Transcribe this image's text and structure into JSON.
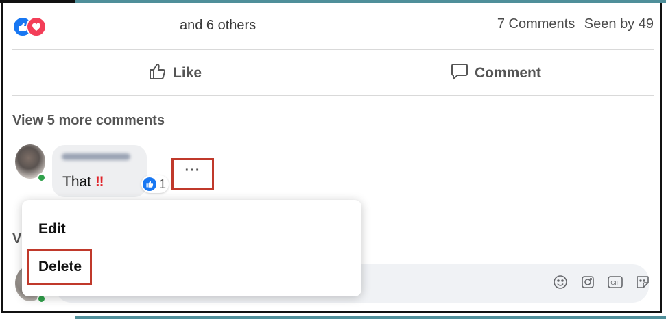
{
  "post_stats": {
    "reaction_icons": [
      "like-icon",
      "love-icon"
    ],
    "reactors_text": "and 6 others",
    "comments_count": "7 Comments",
    "seen_by": "Seen by 49"
  },
  "actions": {
    "like_label": "Like",
    "comment_label": "Comment"
  },
  "comments": {
    "view_more_label": "View 5 more comments",
    "items": [
      {
        "author_blurred": true,
        "text": "That",
        "emoji": "‼",
        "reaction_count": "1"
      }
    ],
    "more_options": "···"
  },
  "context_menu": {
    "items": [
      {
        "label": "Edit"
      },
      {
        "label": "Delete",
        "highlighted": true
      }
    ]
  },
  "obscured_text": "V",
  "composer": {
    "icons": [
      "emoji-icon",
      "camera-icon",
      "gif-icon",
      "sticker-icon"
    ],
    "gif_label": "GIF"
  },
  "colors": {
    "like_blue": "#1877f2",
    "love_red": "#f33e58",
    "highlight_box": "#c0392b",
    "frame_teal": "#4f8f9a"
  }
}
